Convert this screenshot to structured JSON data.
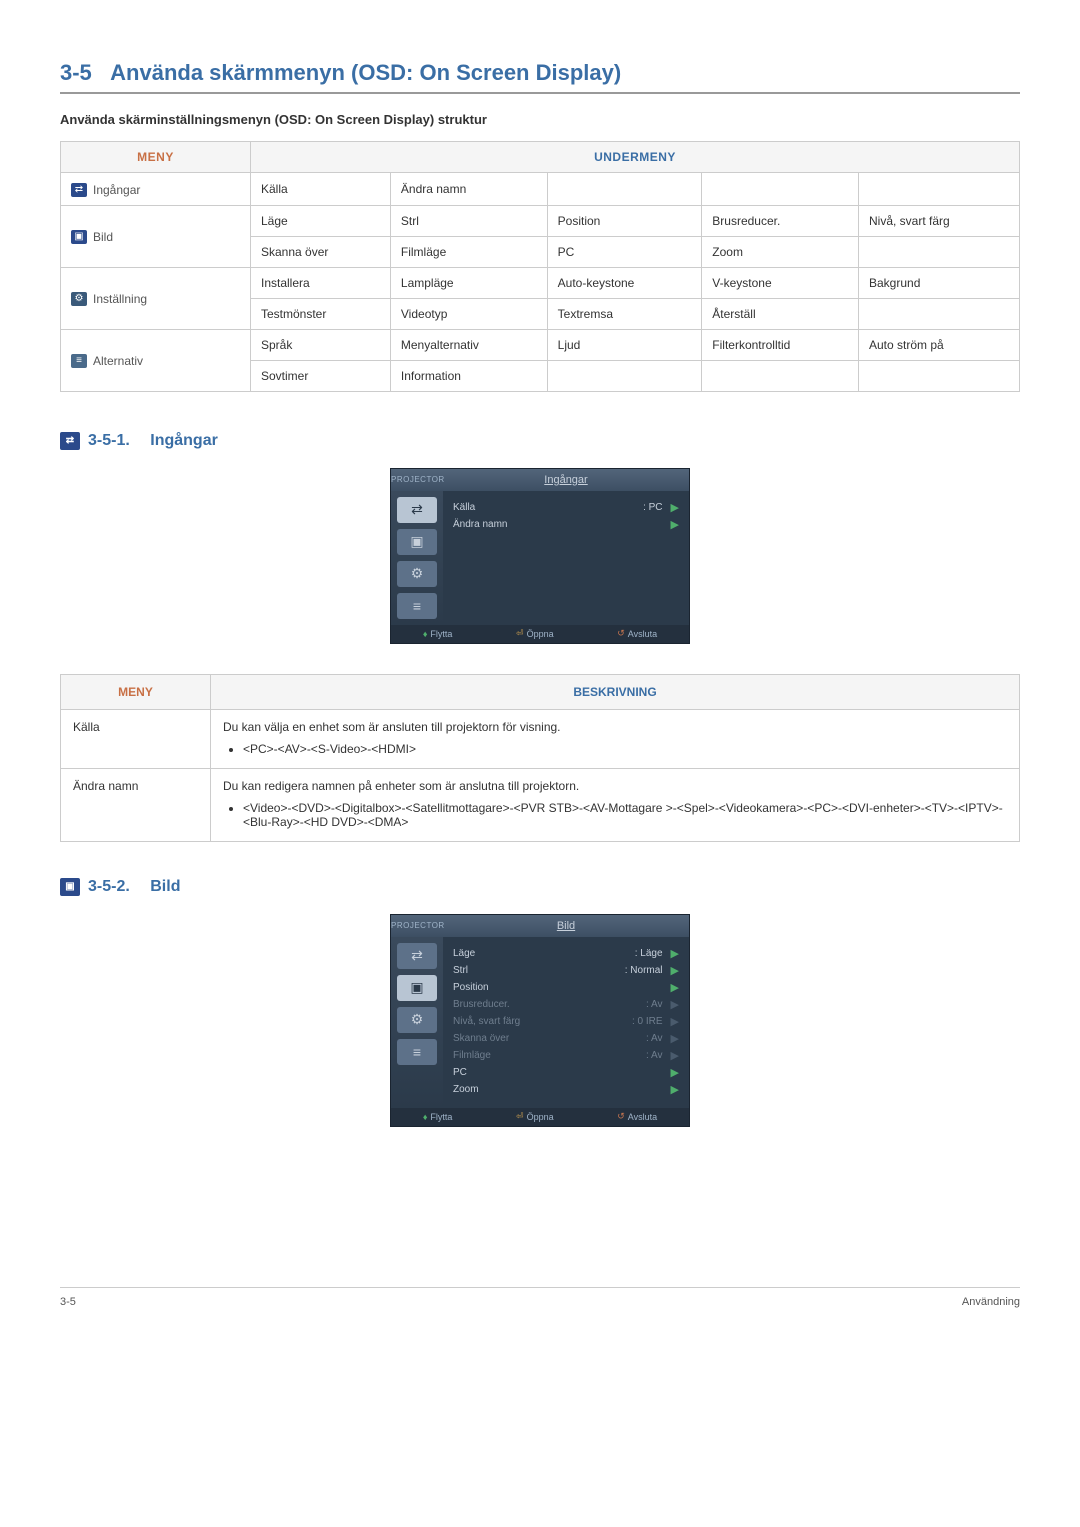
{
  "page": {
    "section_number": "3-5",
    "title": "Använda skärmmenyn (OSD: On Screen Display)",
    "subtitle": "Använda skärminställningsmenyn (OSD: On Screen Display) struktur",
    "footer_left": "3-5",
    "footer_right": "Användning"
  },
  "overview_table": {
    "header_menu": "MENY",
    "header_submenu": "UNDERMENY",
    "rows": [
      {
        "icon": "inputs",
        "label": "Ingångar",
        "sub": [
          [
            "Källa",
            "Ändra namn",
            "",
            "",
            ""
          ]
        ]
      },
      {
        "icon": "picture",
        "label": "Bild",
        "sub": [
          [
            "Läge",
            "Strl",
            "Position",
            "Brusreducer.",
            "Nivå, svart färg"
          ],
          [
            "Skanna över",
            "Filmläge",
            "PC",
            "Zoom",
            ""
          ]
        ]
      },
      {
        "icon": "setup",
        "label": "Inställning",
        "sub": [
          [
            "Installera",
            "Lampläge",
            "Auto-keystone",
            "V-keystone",
            "Bakgrund"
          ],
          [
            "Testmönster",
            "Videotyp",
            "Textremsa",
            "Återställ",
            ""
          ]
        ]
      },
      {
        "icon": "options",
        "label": "Alternativ",
        "sub": [
          [
            "Språk",
            "Menyalternativ",
            "Ljud",
            "Filterkontrolltid",
            "Auto ström på"
          ],
          [
            "Sovtimer",
            "Information",
            "",
            "",
            ""
          ]
        ]
      }
    ]
  },
  "section_inputs": {
    "number": "3-5-1.",
    "title": "Ingångar"
  },
  "osd_inputs": {
    "brand": "PROJECTOR",
    "title": "Ingångar",
    "rows": [
      {
        "label": "Källa",
        "value": ": PC",
        "dim": false
      },
      {
        "label": "Ändra namn",
        "value": "",
        "dim": false
      }
    ],
    "footer": {
      "move": "Flytta",
      "enter": "Öppna",
      "exit": "Avsluta"
    }
  },
  "desc_inputs": {
    "header_menu": "MENY",
    "header_desc": "BESKRIVNING",
    "rows": [
      {
        "menu": "Källa",
        "desc": "Du kan välja en enhet som är ansluten till projektorn för visning.",
        "bullets": [
          "<PC>-<AV>-<S-Video>-<HDMI>"
        ]
      },
      {
        "menu": "Ändra namn",
        "desc": "Du kan redigera namnen på enheter som är anslutna till projektorn.",
        "bullets": [
          "<Video>-<DVD>-<Digitalbox>-<Satellitmottagare>-<PVR STB>-<AV-Mottagare >-<Spel>-<Videokamera>-<PC>-<DVI-enheter>-<TV>-<IPTV>-<Blu-Ray>-<HD DVD>-<DMA>"
        ]
      }
    ]
  },
  "section_picture": {
    "number": "3-5-2.",
    "title": "Bild"
  },
  "osd_picture": {
    "brand": "PROJECTOR",
    "title": "Bild",
    "rows": [
      {
        "label": "Läge",
        "value": ": Läge",
        "dim": false
      },
      {
        "label": "Strl",
        "value": ": Normal",
        "dim": false
      },
      {
        "label": "Position",
        "value": "",
        "dim": false
      },
      {
        "label": "Brusreducer.",
        "value": ": Av",
        "dim": true
      },
      {
        "label": "Nivå, svart färg",
        "value": ": 0 IRE",
        "dim": true
      },
      {
        "label": "Skanna över",
        "value": ": Av",
        "dim": true
      },
      {
        "label": "Filmläge",
        "value": ": Av",
        "dim": true
      },
      {
        "label": "PC",
        "value": "",
        "dim": false
      },
      {
        "label": "Zoom",
        "value": "",
        "dim": false
      }
    ],
    "footer": {
      "move": "Flytta",
      "enter": "Öppna",
      "exit": "Avsluta"
    }
  }
}
